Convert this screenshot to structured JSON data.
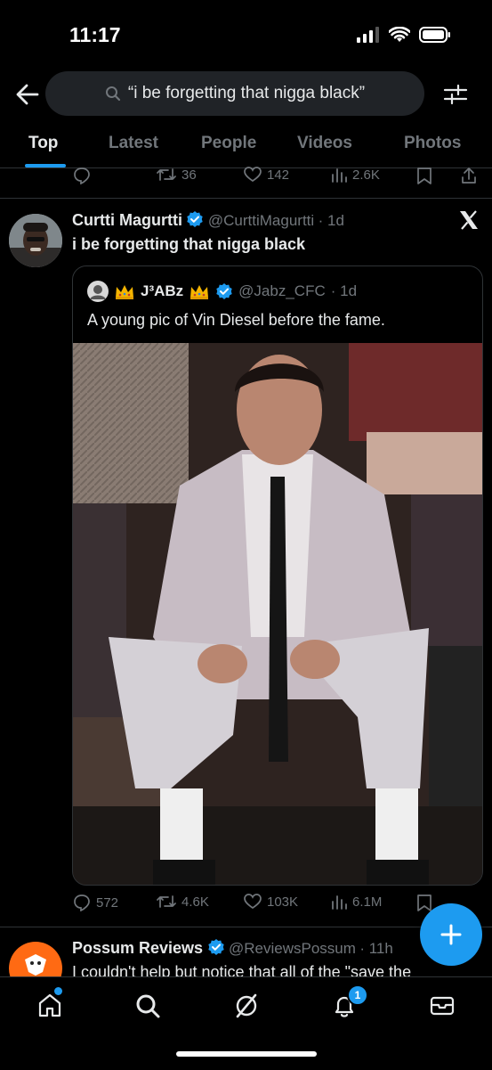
{
  "status_bar": {
    "time": "11:17"
  },
  "search": {
    "query": "“i be forgetting that nigga black”"
  },
  "tabs": [
    {
      "label": "Top"
    },
    {
      "label": "Latest"
    },
    {
      "label": "People"
    },
    {
      "label": "Videos"
    },
    {
      "label": "Photos"
    }
  ],
  "prev_tweet": {
    "retweets": "36",
    "likes": "142",
    "views": "2.6K"
  },
  "tweet": {
    "name": "Curtti Magurtti",
    "handle": "@CurttiMagurtti",
    "time": "· 1d",
    "text": "i be forgetting that nigga black",
    "quote": {
      "name": "J³ABz",
      "handle": "@Jabz_CFC",
      "time": "· 1d",
      "text": "A young pic of Vin Diesel before the fame."
    },
    "replies": "572",
    "retweets": "4.6K",
    "likes": "103K",
    "views": "6.1M"
  },
  "next_tweet": {
    "name": "Possum Reviews",
    "handle": "@ReviewsPossum",
    "time": "· 11h",
    "text": "I couldn't help but notice that all of the \"save the"
  },
  "notifications": {
    "count": "1"
  },
  "colors": {
    "accent": "#1d9bf0",
    "background": "#000000",
    "muted": "#71767b"
  }
}
